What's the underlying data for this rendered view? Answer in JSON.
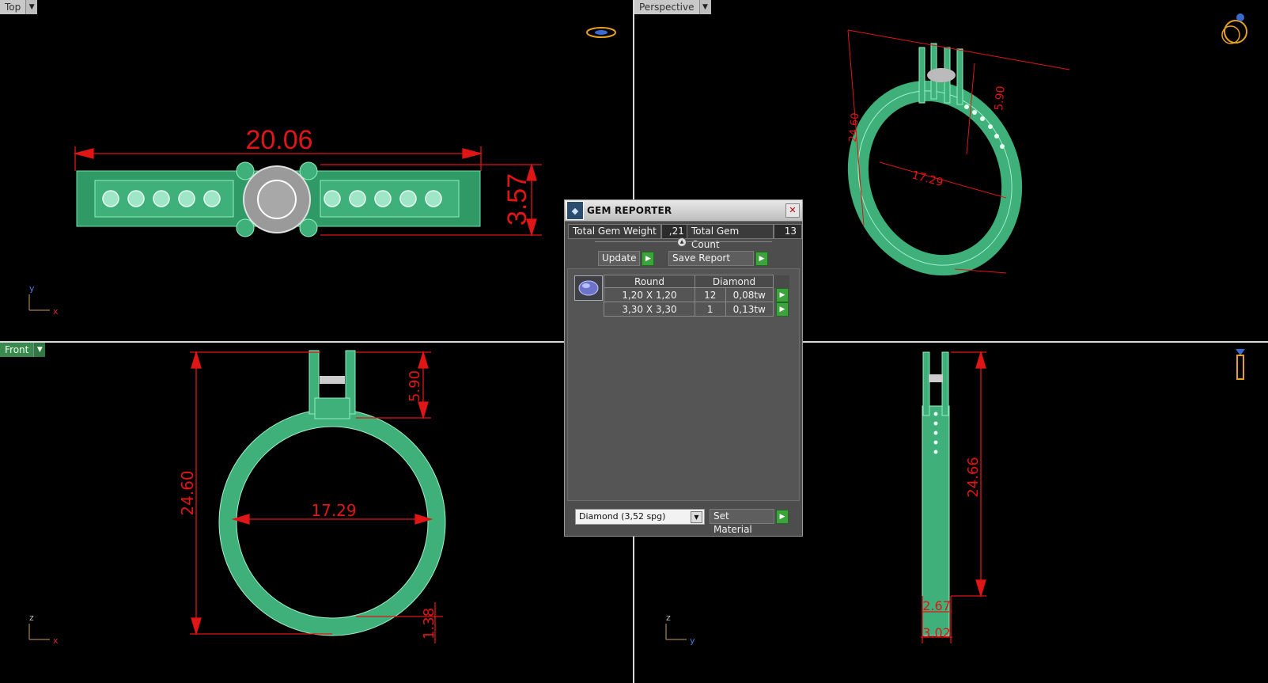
{
  "viewports": {
    "top": {
      "label": "Top",
      "dims": {
        "width": "20.06",
        "height": "3.57"
      },
      "axes": {
        "h": "x",
        "v": "y"
      }
    },
    "perspective": {
      "label": "Perspective",
      "dims": {
        "height": "24.60",
        "diameter": "17.29",
        "head": "5.90"
      }
    },
    "front": {
      "label": "Front",
      "dims": {
        "height": "24.60",
        "head": "5.90",
        "diameter": "17.29",
        "shank": "1.38"
      },
      "axes": {
        "h": "x",
        "v": "z"
      }
    },
    "right": {
      "dims": {
        "height": "24.66",
        "w1": "2.67",
        "w2": "3.02"
      },
      "axes": {
        "h": "y",
        "v": "z"
      }
    }
  },
  "gem_reporter": {
    "title": "GEM REPORTER",
    "total_weight_label": "Total Gem Weight",
    "total_weight_value": ",21",
    "total_count_label": "Total Gem Count",
    "total_count_value": "13",
    "update_label": "Update",
    "save_report_label": "Save Report",
    "table": {
      "headers": [
        "Round",
        "Diamond"
      ],
      "rows": [
        {
          "size": "1,20 X 1,20",
          "count": "12",
          "weight": "0,08tw"
        },
        {
          "size": "3,30 X 3,30",
          "count": "1",
          "weight": "0,13tw"
        }
      ]
    },
    "material_select": "Diamond      (3,52 spg)",
    "set_material_label": "Set Material"
  },
  "colors": {
    "ring": "#3fb07a",
    "dimension": "#e01515",
    "panel_bg": "#4d4d4d"
  },
  "icons": [
    "ring-top-icon",
    "ring-perspective-icon",
    "ring-side-icon",
    "close-icon",
    "play-arrow-icon",
    "round-gem-icon"
  ]
}
